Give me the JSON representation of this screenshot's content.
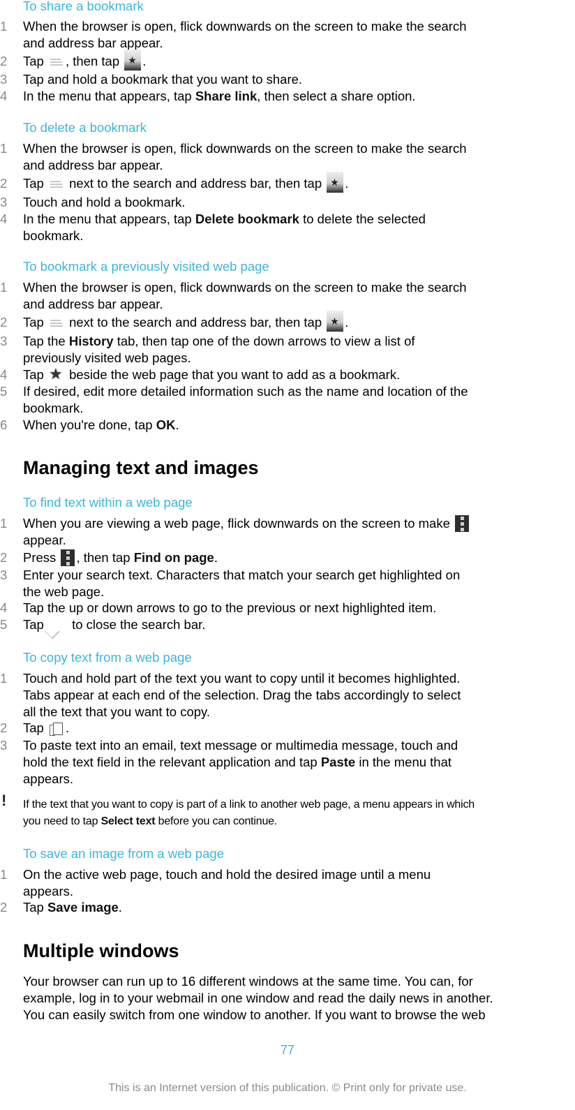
{
  "sections": {
    "share": {
      "title": "To share a bookmark",
      "steps": [
        {
          "num": "1",
          "l1": "When the browser is open, flick downwards on the screen to make the search",
          "l2": "and address bar appear."
        },
        {
          "num": "2",
          "a": "Tap ",
          "b": ", then tap ",
          "c": "."
        },
        {
          "num": "3",
          "l1": "Tap and hold a bookmark that you want to share."
        },
        {
          "num": "4",
          "a": "In the menu that appears, tap ",
          "bold": "Share link",
          "c": ", then select a share option."
        }
      ]
    },
    "delete": {
      "title": "To delete a bookmark",
      "steps": [
        {
          "num": "1",
          "l1": "When the browser is open, flick downwards on the screen to make the search",
          "l2": "and address bar appear."
        },
        {
          "num": "2",
          "a": "Tap ",
          "b": " next to the search and address bar, then tap ",
          "c": "."
        },
        {
          "num": "3",
          "l1": "Touch and hold a bookmark."
        },
        {
          "num": "4",
          "a": "In the menu that appears, tap ",
          "bold": "Delete bookmark",
          "c": " to delete the selected",
          "l2": "bookmark."
        }
      ]
    },
    "history": {
      "title": "To bookmark a previously visited web page",
      "steps": [
        {
          "num": "1",
          "l1": "When the browser is open, flick downwards on the screen to make the search",
          "l2": "and address bar appear."
        },
        {
          "num": "2",
          "a": "Tap ",
          "b": " next to the search and address bar, then tap ",
          "c": "."
        },
        {
          "num": "3",
          "a": "Tap the ",
          "bold": "History",
          "c": " tab, then tap one of the down arrows to view a list of",
          "l2": "previously visited web pages."
        },
        {
          "num": "4",
          "a": "Tap ",
          "c": " beside the web page that you want to add as a bookmark."
        },
        {
          "num": "5",
          "l1": "If desired, edit more detailed information such as the name and location of the",
          "l2": "bookmark."
        },
        {
          "num": "6",
          "a": "When you're done, tap ",
          "bold": "OK",
          "c": "."
        }
      ]
    },
    "managing": {
      "title": "Managing text and images"
    },
    "find": {
      "title": "To find text within a web page",
      "steps": [
        {
          "num": "1",
          "a": "When you are viewing a web page, flick downwards on the screen to make ",
          "l2": "appear."
        },
        {
          "num": "2",
          "a": "Press ",
          "b": ", then tap ",
          "bold": "Find on page",
          "c": "."
        },
        {
          "num": "3",
          "l1": "Enter your search text. Characters that match your search get highlighted on",
          "l2": "the web page."
        },
        {
          "num": "4",
          "l1": "Tap the up or down arrows to go to the previous or next highlighted item."
        },
        {
          "num": "5",
          "a": "Tap ",
          "c": " to close the search bar."
        }
      ]
    },
    "copy": {
      "title": "To copy text from a web page",
      "steps": [
        {
          "num": "1",
          "l1": "Touch and hold part of the text you want to copy until it becomes highlighted.",
          "l2": "Tabs appear at each end of the selection. Drag the tabs accordingly to select",
          "l3": "all the text that you want to copy."
        },
        {
          "num": "2",
          "a": "Tap ",
          "c": "."
        },
        {
          "num": "3",
          "l1": "To paste text into an email, text message or multimedia message, touch and",
          "a": "hold the text field in the relevant application and tap ",
          "bold": "Paste",
          "c": " in the menu that",
          "l3": "appears."
        }
      ],
      "note": {
        "icon": "!",
        "l1": "If the text that you want to copy is part of a link to another web page, a menu appears in which",
        "a": "you need to tap ",
        "bold": "Select text",
        "c": " before you can continue."
      }
    },
    "save": {
      "title": "To save an image from a web page",
      "steps": [
        {
          "num": "1",
          "l1": "On the active web page, touch and hold the desired image until a menu",
          "l2": "appears."
        },
        {
          "num": "2",
          "a": "Tap ",
          "bold": "Save image",
          "c": "."
        }
      ]
    },
    "multiple": {
      "title": "Multiple windows",
      "lines": [
        "Your browser can run up to 16 different windows at the same time. You can, for",
        "example, log in to your webmail in one window and read the daily news in another.",
        "You can easily switch from one window to another. If you want to browse the web"
      ]
    }
  },
  "icons": {
    "menu": "menu-lines-icon",
    "bookmarks": "bookmarks-star-icon",
    "star": "add-bookmark-star-icon",
    "overflow": "overflow-menu-icon",
    "check": "checkmark-icon",
    "copy": "copy-icon",
    "note": "exclamation-icon"
  },
  "colors": {
    "accent": "#3db5da",
    "step_number": "#888888",
    "footer": "#8a8a8a"
  },
  "page_number": "77",
  "footer": "This is an Internet version of this publication. © Print only for private use."
}
